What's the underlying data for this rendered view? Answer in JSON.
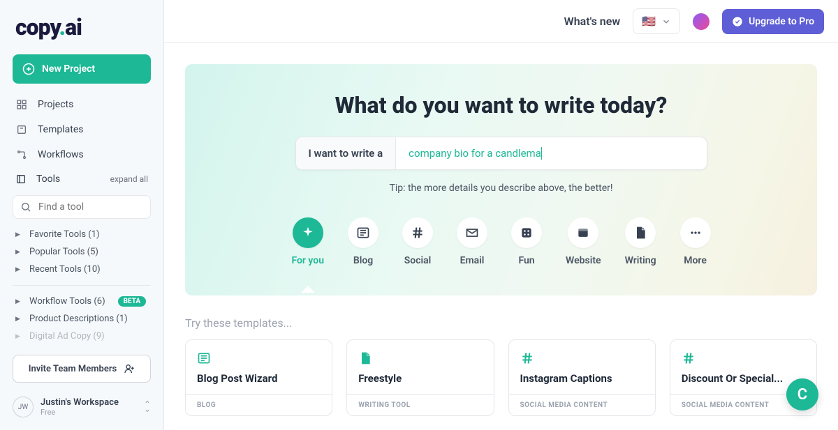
{
  "brand": {
    "a": "copy",
    "b": "ai"
  },
  "sidebar": {
    "new_project": "New Project",
    "nav": [
      {
        "label": "Projects"
      },
      {
        "label": "Templates"
      },
      {
        "label": "Workflows"
      }
    ],
    "tools_label": "Tools",
    "expand": "expand all",
    "search_placeholder": "Find a tool",
    "tree1": [
      {
        "label": "Favorite Tools (1)"
      },
      {
        "label": "Popular Tools (5)"
      },
      {
        "label": "Recent Tools (10)"
      }
    ],
    "tree2": [
      {
        "label": "Workflow Tools (6)",
        "beta": "BETA"
      },
      {
        "label": "Product Descriptions (1)"
      },
      {
        "label": "Digital Ad Copy (9)"
      }
    ],
    "invite": "Invite Team Members",
    "workspace": {
      "initials": "JW",
      "name": "Justin's Workspace",
      "plan": "Free"
    }
  },
  "topbar": {
    "whatsnew": "What's new",
    "lang_flag": "🇺🇸",
    "upgrade": "Upgrade to Pro"
  },
  "hero": {
    "title": "What do you want to write today?",
    "prefix": "I want to write a",
    "typing": "company bio for a candlema",
    "tip": "Tip: the more details you describe above, the better!"
  },
  "categories": [
    {
      "label": "For you",
      "icon": "sparkle",
      "active": true
    },
    {
      "label": "Blog",
      "icon": "blog"
    },
    {
      "label": "Social",
      "icon": "hash"
    },
    {
      "label": "Email",
      "icon": "mail"
    },
    {
      "label": "Fun",
      "icon": "dice"
    },
    {
      "label": "Website",
      "icon": "window"
    },
    {
      "label": "Writing",
      "icon": "doc"
    },
    {
      "label": "More",
      "icon": "dots"
    }
  ],
  "templates_header": "Try these templates...",
  "cards": [
    {
      "icon": "blog",
      "title": "Blog Post Wizard",
      "cat": "BLOG"
    },
    {
      "icon": "doc",
      "title": "Freestyle",
      "cat": "WRITING TOOL"
    },
    {
      "icon": "hash",
      "title": "Instagram Captions",
      "cat": "SOCIAL MEDIA CONTENT"
    },
    {
      "icon": "hash",
      "title": "Discount Or Special...",
      "cat": "SOCIAL MEDIA CONTENT"
    }
  ],
  "fab": "C"
}
